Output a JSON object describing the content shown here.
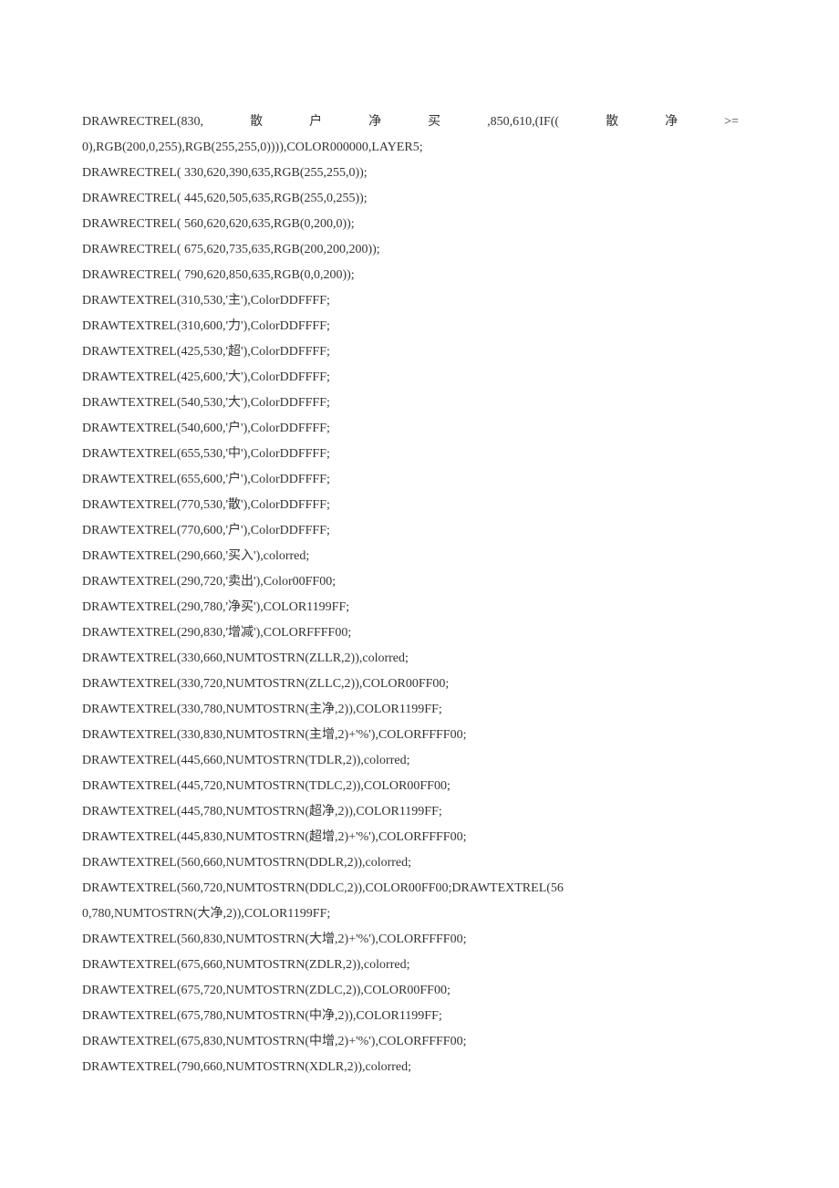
{
  "lines": [
    {
      "type": "justified",
      "parts": [
        "DRAWRECTREL(830,",
        "散",
        "户",
        "净",
        "买",
        ",850,610,(IF((",
        "散",
        "净",
        ">="
      ]
    },
    {
      "type": "plain",
      "text": "0),RGB(200,0,255),RGB(255,255,0)))),COLOR000000,LAYER5;"
    },
    {
      "type": "plain",
      "text": "DRAWRECTREL( 330,620,390,635,RGB(255,255,0));"
    },
    {
      "type": "plain",
      "text": "DRAWRECTREL( 445,620,505,635,RGB(255,0,255));"
    },
    {
      "type": "plain",
      "text": "DRAWRECTREL( 560,620,620,635,RGB(0,200,0));"
    },
    {
      "type": "plain",
      "text": "DRAWRECTREL( 675,620,735,635,RGB(200,200,200));"
    },
    {
      "type": "plain",
      "text": "DRAWRECTREL( 790,620,850,635,RGB(0,0,200));"
    },
    {
      "type": "plain",
      "text": "DRAWTEXTREL(310,530,'主'),ColorDDFFFF;"
    },
    {
      "type": "plain",
      "text": "DRAWTEXTREL(310,600,'力'),ColorDDFFFF;"
    },
    {
      "type": "plain",
      "text": "DRAWTEXTREL(425,530,'超'),ColorDDFFFF;"
    },
    {
      "type": "plain",
      "text": "DRAWTEXTREL(425,600,'大'),ColorDDFFFF;"
    },
    {
      "type": "plain",
      "text": "DRAWTEXTREL(540,530,'大'),ColorDDFFFF;"
    },
    {
      "type": "plain",
      "text": "DRAWTEXTREL(540,600,'户'),ColorDDFFFF;"
    },
    {
      "type": "plain",
      "text": "DRAWTEXTREL(655,530,'中'),ColorDDFFFF;"
    },
    {
      "type": "plain",
      "text": "DRAWTEXTREL(655,600,'户'),ColorDDFFFF;"
    },
    {
      "type": "plain",
      "text": "DRAWTEXTREL(770,530,'散'),ColorDDFFFF;"
    },
    {
      "type": "plain",
      "text": "DRAWTEXTREL(770,600,'户'),ColorDDFFFF;"
    },
    {
      "type": "plain",
      "text": "DRAWTEXTREL(290,660,'买入'),colorred;"
    },
    {
      "type": "plain",
      "text": "DRAWTEXTREL(290,720,'卖出'),Color00FF00;"
    },
    {
      "type": "plain",
      "text": "DRAWTEXTREL(290,780,'净买'),COLOR1199FF;"
    },
    {
      "type": "plain",
      "text": "DRAWTEXTREL(290,830,'增减'),COLORFFFF00;"
    },
    {
      "type": "plain",
      "text": "DRAWTEXTREL(330,660,NUMTOSTRN(ZLLR,2)),colorred;"
    },
    {
      "type": "plain",
      "text": "DRAWTEXTREL(330,720,NUMTOSTRN(ZLLC,2)),COLOR00FF00;"
    },
    {
      "type": "plain",
      "text": "DRAWTEXTREL(330,780,NUMTOSTRN(主净,2)),COLOR1199FF;"
    },
    {
      "type": "plain",
      "text": "DRAWTEXTREL(330,830,NUMTOSTRN(主增,2)+'%'),COLORFFFF00;"
    },
    {
      "type": "plain",
      "text": "DRAWTEXTREL(445,660,NUMTOSTRN(TDLR,2)),colorred;"
    },
    {
      "type": "plain",
      "text": "DRAWTEXTREL(445,720,NUMTOSTRN(TDLC,2)),COLOR00FF00;"
    },
    {
      "type": "plain",
      "text": "DRAWTEXTREL(445,780,NUMTOSTRN(超净,2)),COLOR1199FF;"
    },
    {
      "type": "plain",
      "text": "DRAWTEXTREL(445,830,NUMTOSTRN(超增,2)+'%'),COLORFFFF00;"
    },
    {
      "type": "plain",
      "text": "DRAWTEXTREL(560,660,NUMTOSTRN(DDLR,2)),colorred;"
    },
    {
      "type": "plain",
      "text": "DRAWTEXTREL(560,720,NUMTOSTRN(DDLC,2)),COLOR00FF00;DRAWTEXTREL(56"
    },
    {
      "type": "plain",
      "text": "0,780,NUMTOSTRN(大净,2)),COLOR1199FF;"
    },
    {
      "type": "plain",
      "text": "DRAWTEXTREL(560,830,NUMTOSTRN(大增,2)+'%'),COLORFFFF00;"
    },
    {
      "type": "plain",
      "text": "DRAWTEXTREL(675,660,NUMTOSTRN(ZDLR,2)),colorred;"
    },
    {
      "type": "plain",
      "text": "DRAWTEXTREL(675,720,NUMTOSTRN(ZDLC,2)),COLOR00FF00;"
    },
    {
      "type": "plain",
      "text": "DRAWTEXTREL(675,780,NUMTOSTRN(中净,2)),COLOR1199FF;"
    },
    {
      "type": "plain",
      "text": "DRAWTEXTREL(675,830,NUMTOSTRN(中增,2)+'%'),COLORFFFF00;"
    },
    {
      "type": "plain",
      "text": "DRAWTEXTREL(790,660,NUMTOSTRN(XDLR,2)),colorred;"
    }
  ]
}
